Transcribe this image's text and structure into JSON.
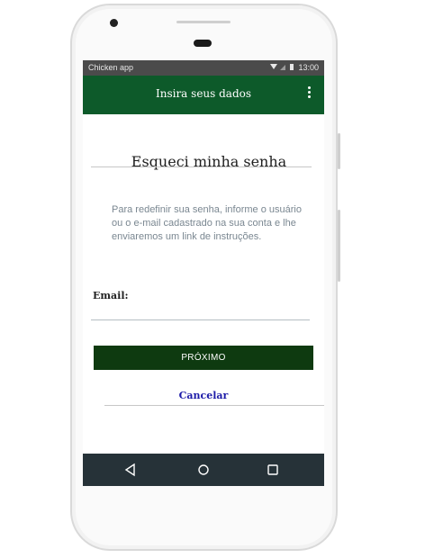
{
  "status_bar": {
    "app_name": "Chicken app",
    "time": "13:00"
  },
  "app_bar": {
    "title": "Insira seus dados",
    "menu_icon": "more-vert-icon"
  },
  "main": {
    "heading": "Esqueci minha senha",
    "description": "Para redefinir sua senha, informe o usuário ou o e-mail cadastrado na sua conta e lhe enviaremos um link de instruções.",
    "email_label": "Email:",
    "email_value": "",
    "next_button": "PRÓXIMO",
    "cancel_link": "Cancelar"
  },
  "nav_bar": {
    "icons": [
      "back-triangle-icon",
      "home-circle-icon",
      "recent-square-icon"
    ]
  },
  "colors": {
    "app_bar": "#0d5a2a",
    "button": "#0e3a10",
    "link": "#1d1ba8",
    "nav_bar": "#263238"
  }
}
